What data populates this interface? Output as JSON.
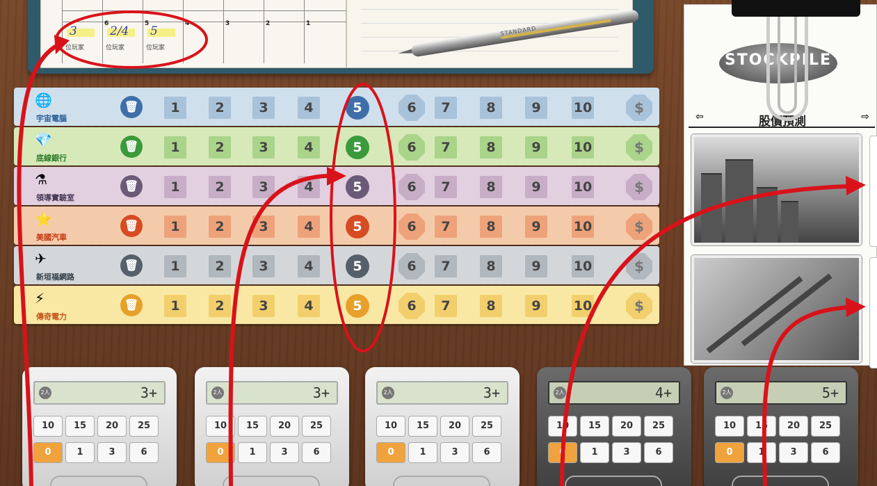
{
  "scoresheet": {
    "columns": [
      {
        "num": "",
        "hand": "3",
        "players": "位玩家"
      },
      {
        "num": "6",
        "hand": "2/4",
        "players": "位玩家"
      },
      {
        "num": "5",
        "hand": "5",
        "players": "位玩家"
      },
      {
        "num": "4",
        "hand": "",
        "players": ""
      },
      {
        "num": "3",
        "hand": "",
        "players": ""
      },
      {
        "num": "2",
        "hand": "",
        "players": ""
      },
      {
        "num": "1",
        "hand": "",
        "players": ""
      }
    ]
  },
  "pen": {
    "brand": "STANDARD"
  },
  "stocks": [
    {
      "name": "宇宙電腦",
      "icon": "🌐",
      "bg": "#cfe0ec",
      "accent": "#3f6fa8",
      "cell": "#a8c2da",
      "name_color": "#2b5d9a"
    },
    {
      "name": "底線銀行",
      "icon": "💎",
      "bg": "#d7e9b8",
      "accent": "#3b9a3b",
      "cell": "#a9d48a",
      "name_color": "#2a7a2a"
    },
    {
      "name": "領導實驗室",
      "icon": "⚗",
      "bg": "#e2cfe0",
      "accent": "#6a5a78",
      "cell": "#c7aec6",
      "name_color": "#4a3d58"
    },
    {
      "name": "美國汽車",
      "icon": "⭐",
      "bg": "#f4cbaa",
      "accent": "#d74b23",
      "cell": "#eea27a",
      "name_color": "#c43a14"
    },
    {
      "name": "新垣福網路",
      "icon": "✈",
      "bg": "#d4d7da",
      "accent": "#55606a",
      "cell": "#b0b7bd",
      "name_color": "#333d46"
    },
    {
      "name": "傳奇電力",
      "icon": "⚡",
      "bg": "#f8e8a4",
      "accent": "#e7a02a",
      "cell": "#f2cf6c",
      "name_color": "#c6541a"
    }
  ],
  "track": {
    "cells": [
      "1",
      "2",
      "3",
      "4",
      "5",
      "6",
      "7",
      "8",
      "9",
      "10"
    ],
    "trash_label": "🗑",
    "dollar_label": "$"
  },
  "forecast": {
    "logo": "STOCKPILE",
    "title": "股價預測",
    "left_mark": "⇦",
    "right_mark": "⇨"
  },
  "calculators": [
    {
      "style": "light",
      "display": "3+",
      "badge": "2人",
      "keys": [
        "10",
        "15",
        "20",
        "25",
        "0",
        "1",
        "3",
        "6"
      ]
    },
    {
      "style": "light",
      "display": "3+",
      "badge": "2人",
      "keys": [
        "10",
        "15",
        "20",
        "25",
        "0",
        "1",
        "3",
        "6"
      ]
    },
    {
      "style": "light",
      "display": "3+",
      "badge": "2人",
      "keys": [
        "10",
        "15",
        "20",
        "25",
        "0",
        "1",
        "3",
        "6"
      ]
    },
    {
      "style": "dark",
      "display": "4+",
      "badge": "2人",
      "keys": [
        "10",
        "15",
        "20",
        "25",
        "0",
        "1",
        "3",
        "6"
      ]
    },
    {
      "style": "dark",
      "display": "5+",
      "badge": "2人",
      "keys": [
        "10",
        "15",
        "20",
        "25",
        "0",
        "1",
        "3",
        "6"
      ]
    }
  ],
  "colors": {
    "annotation": "#d9121a"
  }
}
